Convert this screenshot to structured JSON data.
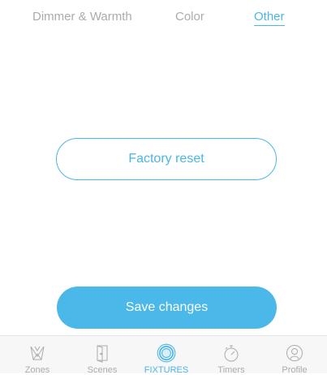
{
  "tabs": [
    {
      "label": "Dimmer & Warmth"
    },
    {
      "label": "Color"
    },
    {
      "label": "Other",
      "active": true
    }
  ],
  "actions": {
    "factory_reset_label": "Factory reset",
    "save_label": "Save changes"
  },
  "bottom_nav": {
    "items": [
      {
        "label": "Zones",
        "icon": "crown-icon"
      },
      {
        "label": "Scenes",
        "icon": "door-icon"
      },
      {
        "label": "FIXTURES",
        "icon": "fixture-icon",
        "active": true
      },
      {
        "label": "Timers",
        "icon": "stopwatch-icon"
      },
      {
        "label": "Profile",
        "icon": "profile-icon"
      }
    ]
  },
  "colors": {
    "accent": "#4ab6e6",
    "inactive": "#a9acae",
    "nav_background": "#f7f7f7"
  }
}
